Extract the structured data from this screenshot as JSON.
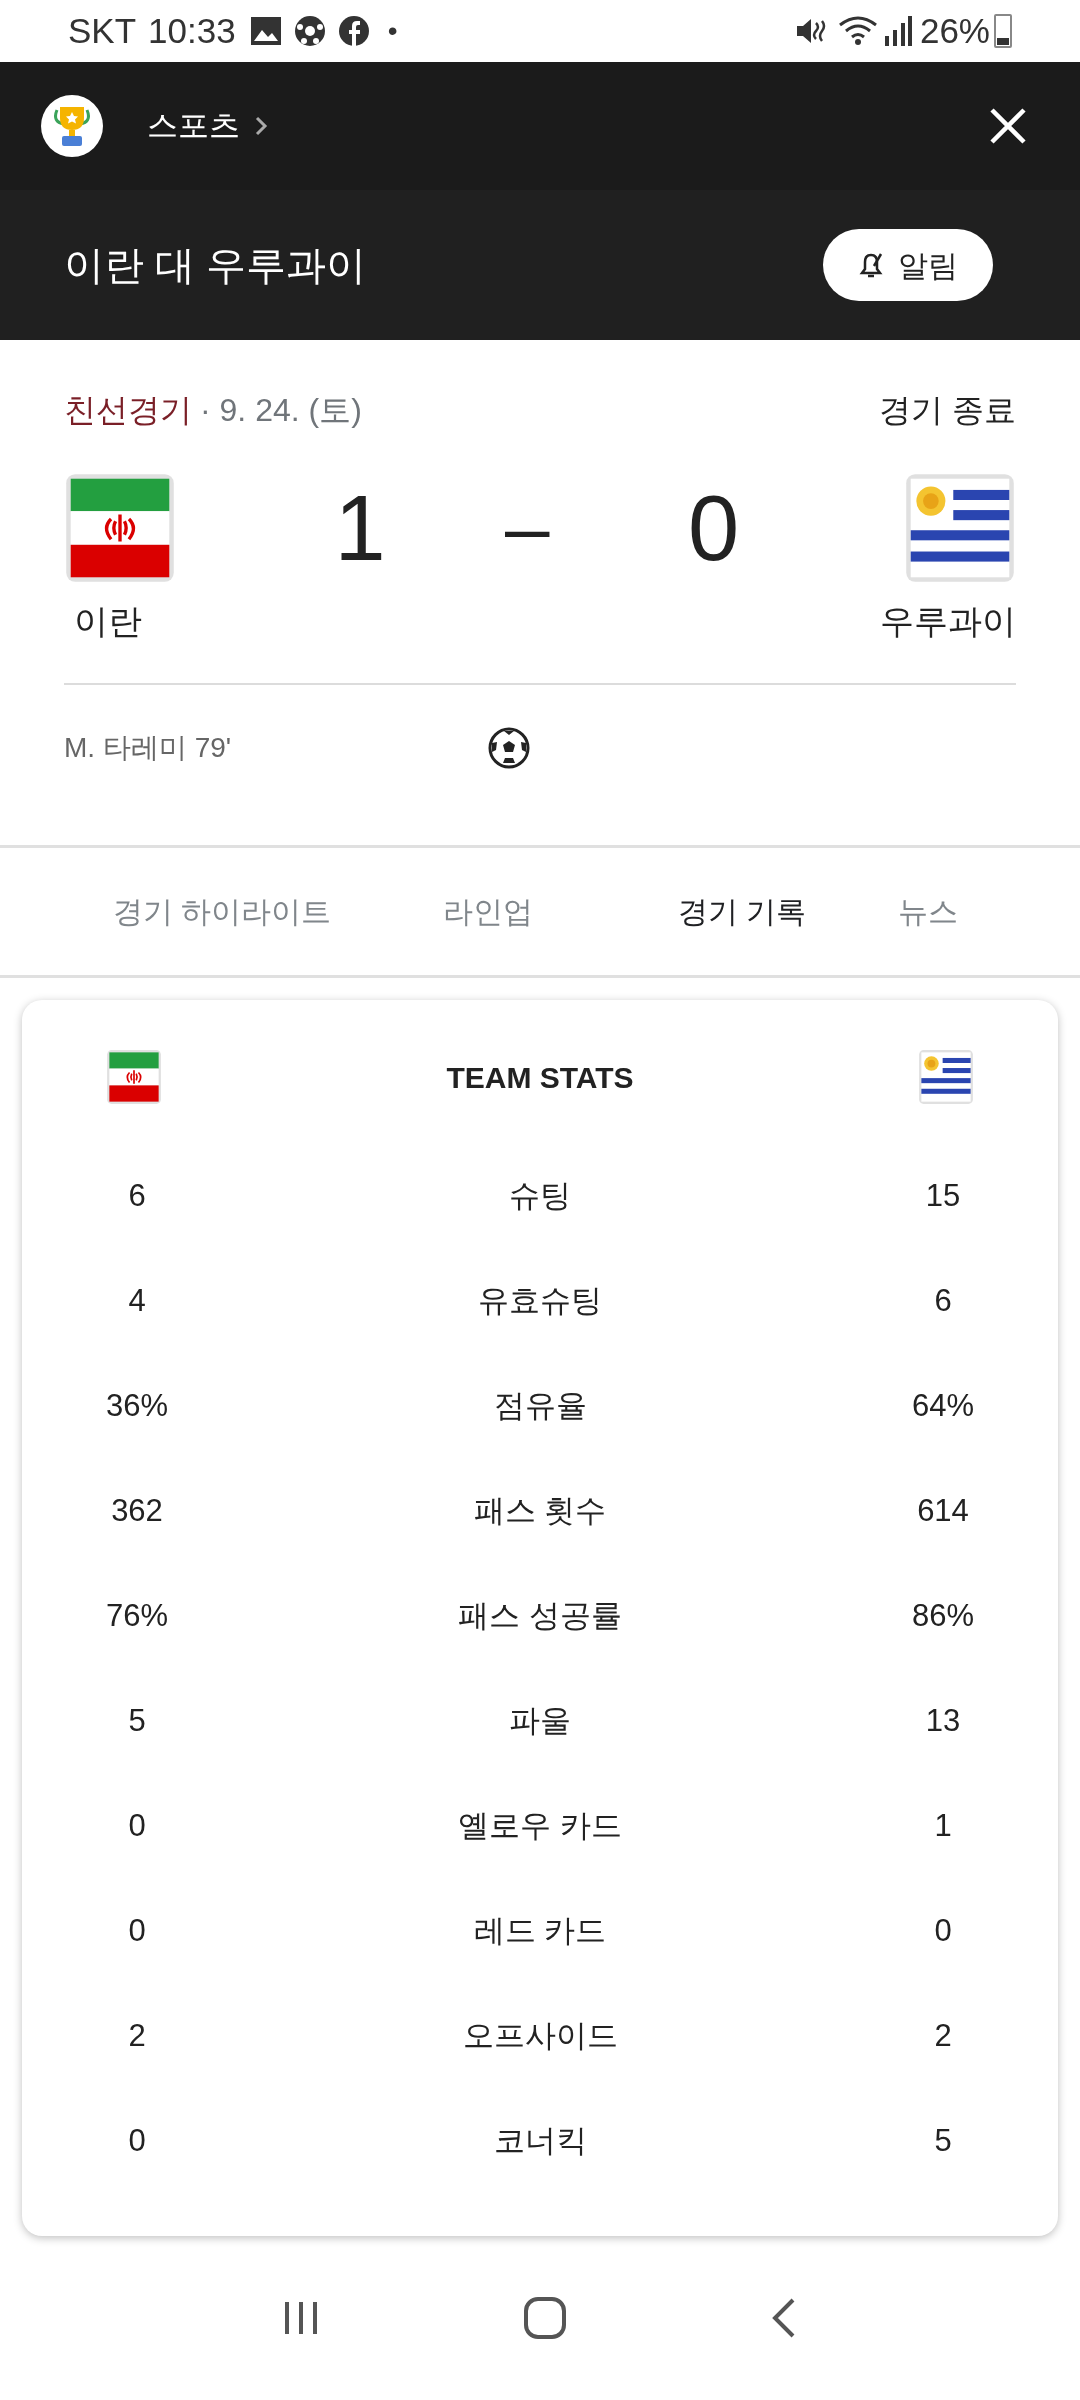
{
  "status_bar": {
    "carrier": "SKT",
    "time": "10:33",
    "dot": "•",
    "battery": "26%"
  },
  "header": {
    "section": "스포츠",
    "title": "이란 대 우루과이",
    "alert_button": "알림"
  },
  "match": {
    "competition": "친선경기",
    "date": "· 9. 24. (토)",
    "status": "경기 종료",
    "separator": "–",
    "home": {
      "name": "이란",
      "score": "1"
    },
    "away": {
      "name": "우루과이",
      "score": "0"
    },
    "scorers": [
      {
        "text": "M. 타레미 79'"
      }
    ]
  },
  "tabs": [
    {
      "label": "경기 하이라이트",
      "selected": false
    },
    {
      "label": "라인업",
      "selected": false
    },
    {
      "label": "경기 기록",
      "selected": true
    },
    {
      "label": "뉴스",
      "selected": false
    }
  ],
  "team_stats": {
    "title": "TEAM STATS",
    "rows": [
      {
        "home": "6",
        "label": "슈팅",
        "away": "15"
      },
      {
        "home": "4",
        "label": "유효슈팅",
        "away": "6"
      },
      {
        "home": "36%",
        "label": "점유율",
        "away": "64%"
      },
      {
        "home": "362",
        "label": "패스 횟수",
        "away": "614"
      },
      {
        "home": "76%",
        "label": "패스 성공률",
        "away": "86%"
      },
      {
        "home": "5",
        "label": "파울",
        "away": "13"
      },
      {
        "home": "0",
        "label": "옐로우 카드",
        "away": "1"
      },
      {
        "home": "0",
        "label": "레드 카드",
        "away": "0"
      },
      {
        "home": "2",
        "label": "오프사이드",
        "away": "2"
      },
      {
        "home": "0",
        "label": "코너킥",
        "away": "5"
      }
    ]
  }
}
